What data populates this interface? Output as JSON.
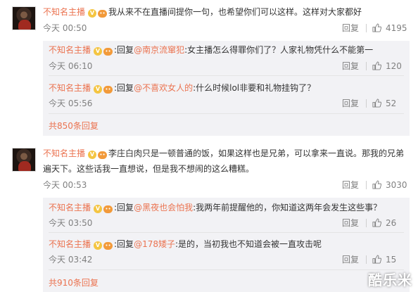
{
  "threads": [
    {
      "author": "不知名主播",
      "text": "我从来不在直播间提你一句，也希望你们可以这样。这样对大家都好",
      "time": "今天 00:50",
      "reply_label": "回复",
      "likes": "4195",
      "subreplies": [
        {
          "author": "不知名主播",
          "prefix": ":回复",
          "mention": "@南京流窜犯",
          "text": ":女主播怎么得罪你们了？人家礼物凭什么不能第一",
          "time": "今天 06:10",
          "reply_label": "回复",
          "likes": "120"
        },
        {
          "author": "不知名主播",
          "prefix": ":回复",
          "mention": "@不喜欢女人的",
          "text": ":什么时候lol非要和礼物挂钩了？",
          "time": "今天 05:56",
          "reply_label": "回复",
          "likes": "52"
        }
      ],
      "more": "共850条回复"
    },
    {
      "author": "不知名主播",
      "text_line1": "李庄白肉只是一顿普通的饭，如果这样也是兄弟，可以拿来一直说。那我的兄弟",
      "text_line2": "遍天下。这些话我一直想说，但是我不想闹的这么糟糕。",
      "time": "今天 00:53",
      "reply_label": "回复",
      "likes": "3030",
      "subreplies": [
        {
          "author": "不知名主播",
          "prefix": ":回复",
          "mention": "@黑夜也会怕我",
          "text": ":我两年前提醒他的，你知道这两年会发生这些事？",
          "time": "今天 03:50",
          "reply_label": "回复",
          "likes": "26"
        },
        {
          "author": "不知名主播",
          "prefix": ":回复",
          "mention": "@178矮子",
          "text": ":是的，当初我也不知道会被一直攻击呢",
          "time": "今天 03:42",
          "reply_label": "回复",
          "likes": "15"
        }
      ],
      "more": "共910条回复"
    }
  ],
  "icons": {
    "verified": "verified-badge-icon",
    "bubble": "chat-bubble-icon",
    "like": "thumb-up-icon"
  },
  "watermark": "酷乐米",
  "colors": {
    "name": "#eb7350",
    "meta": "#808080",
    "subbox": "#f2f2f5"
  }
}
